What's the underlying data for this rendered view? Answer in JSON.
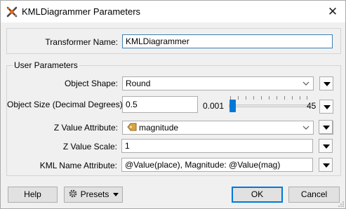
{
  "window": {
    "title": "KMLDiagrammer Parameters",
    "close_glyph": "✕"
  },
  "transformer": {
    "label": "Transformer Name:",
    "value": "KMLDiagrammer"
  },
  "user_parameters": {
    "legend": "User Parameters",
    "object_shape": {
      "label": "Object Shape:",
      "value": "Round"
    },
    "object_size": {
      "label": "Object Size (Decimal Degrees):",
      "value": "0.5",
      "slider_min": "0.001",
      "slider_max": "45",
      "slider_fraction": 0.011
    },
    "z_value_attribute": {
      "label": "Z Value Attribute:",
      "value": "magnitude",
      "browse_label": "..."
    },
    "z_value_scale": {
      "label": "Z Value Scale:",
      "value": "1"
    },
    "kml_name_attribute": {
      "label": "KML Name Attribute:",
      "value": "@Value(place),  Magnitude: @Value(mag)"
    }
  },
  "footer": {
    "help": "Help",
    "presets": "Presets",
    "ok": "OK",
    "cancel": "Cancel"
  },
  "colors": {
    "accent": "#0078d7",
    "focus_border": "#3c7fb1",
    "background": "#f0f0f0"
  },
  "icons": [
    "fme-transformer-icon",
    "close-icon",
    "chevron-down-icon",
    "attribute-tag-icon",
    "gear-icon",
    "menu-triangle-icon"
  ]
}
